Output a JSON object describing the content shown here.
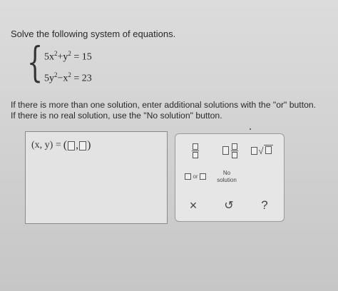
{
  "prompt": "Solve the following system of equations.",
  "system": {
    "eq1": {
      "a": "5x",
      "b": "+y",
      "rhs": "= 15"
    },
    "eq2": {
      "a": "5y",
      "b": "−x",
      "rhs": "= 23"
    },
    "exponent": "2"
  },
  "instructions": {
    "line1": "If there is more than one solution, enter additional solutions with the \"or\" button.",
    "line2": "If there is no real solution, use the \"No solution\" button."
  },
  "answer": {
    "label": "(x, y) =",
    "open": "(",
    "comma": ",",
    "close": ")"
  },
  "palette": {
    "or_label": "or",
    "no_solution_line1": "No",
    "no_solution_line2": "solution",
    "clear_symbol": "×",
    "undo_symbol": "↺",
    "help_symbol": "?"
  }
}
